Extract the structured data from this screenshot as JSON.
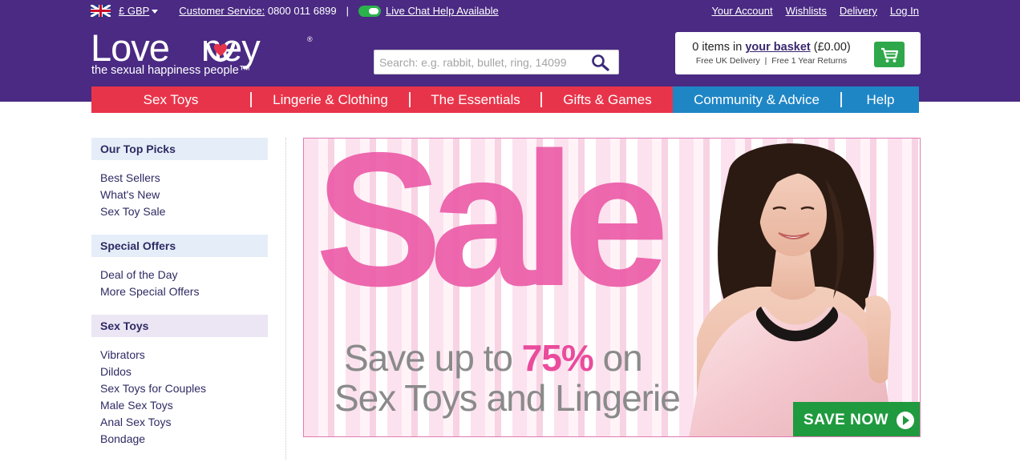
{
  "topbar": {
    "currency": "£ GBP",
    "customer_service_label": "Customer Service:",
    "customer_service_phone": "0800 011 6899",
    "divider": "|",
    "live_chat": "Live Chat Help Available",
    "links": [
      "Your Account",
      "Wishlists",
      "Delivery",
      "Log In"
    ]
  },
  "logo": {
    "wordmark_left": "Love",
    "wordmark_right": "ney",
    "tagline": "the sexual happiness people™",
    "registered": "®"
  },
  "search": {
    "placeholder": "Search: e.g. rabbit, bullet, ring, 14099"
  },
  "basket": {
    "items_text": "0 items in",
    "basket_link": "your basket",
    "total": "(£0.00)",
    "delivery": "Free UK Delivery",
    "sep": "|",
    "returns": "Free 1 Year Returns"
  },
  "nav": {
    "items": [
      "Sex Toys",
      "Lingerie & Clothing",
      "The Essentials",
      "Gifts & Games",
      "Community & Advice",
      "Help"
    ],
    "sep": "|"
  },
  "sidebar": {
    "groups": [
      {
        "title": "Our Top Picks",
        "links": [
          "Best Sellers",
          "What's New",
          "Sex Toy Sale"
        ]
      },
      {
        "title": "Special Offers",
        "links": [
          "Deal of the Day",
          "More Special Offers"
        ]
      },
      {
        "title": "Sex Toys",
        "links": [
          "Vibrators",
          "Dildos",
          "Sex Toys for Couples",
          "Male Sex Toys",
          "Anal Sex Toys",
          "Bondage"
        ]
      }
    ]
  },
  "banner": {
    "headline": "Sale",
    "line1_pre": "Save up to ",
    "line1_pct": "75%",
    "line1_post": " on",
    "line2": "Sex Toys and Lingerie",
    "cta": "SAVE NOW"
  },
  "colors": {
    "header_bg": "#4a2a83",
    "nav_red": "#e8344a",
    "nav_blue": "#1f86c6",
    "cta_green": "#1f9a3e",
    "pink": "#ec5aa7"
  }
}
